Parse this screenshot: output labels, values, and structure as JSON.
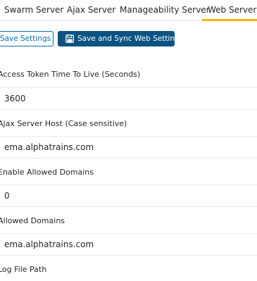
{
  "tabs": [
    {
      "label": "Swarm Server"
    },
    {
      "label": "Ajax Server"
    },
    {
      "label": "Manageability Server"
    },
    {
      "label": "Web Server",
      "active": true
    }
  ],
  "toolbar": {
    "save_label": "Save Settings",
    "save_sync_label": "Save and Sync Web Settings",
    "save_sync_icon": "floppy-disk-icon"
  },
  "fields": [
    {
      "label": "Access Token Time To Live (Seconds)",
      "value": "3600"
    },
    {
      "label": "Ajax Server Host (Case sensitive)",
      "value": "ema.alphatrains.com"
    },
    {
      "label": "Enable Allowed Domains",
      "value": "0"
    },
    {
      "label": "Allowed Domains",
      "value": "ema.alphatrains.com"
    },
    {
      "label": "Log File Path",
      "value": ""
    }
  ],
  "colors": {
    "accent_tab": "#f5b400",
    "primary_button": "#0a5382",
    "outline_button": "#0b6fa6"
  }
}
